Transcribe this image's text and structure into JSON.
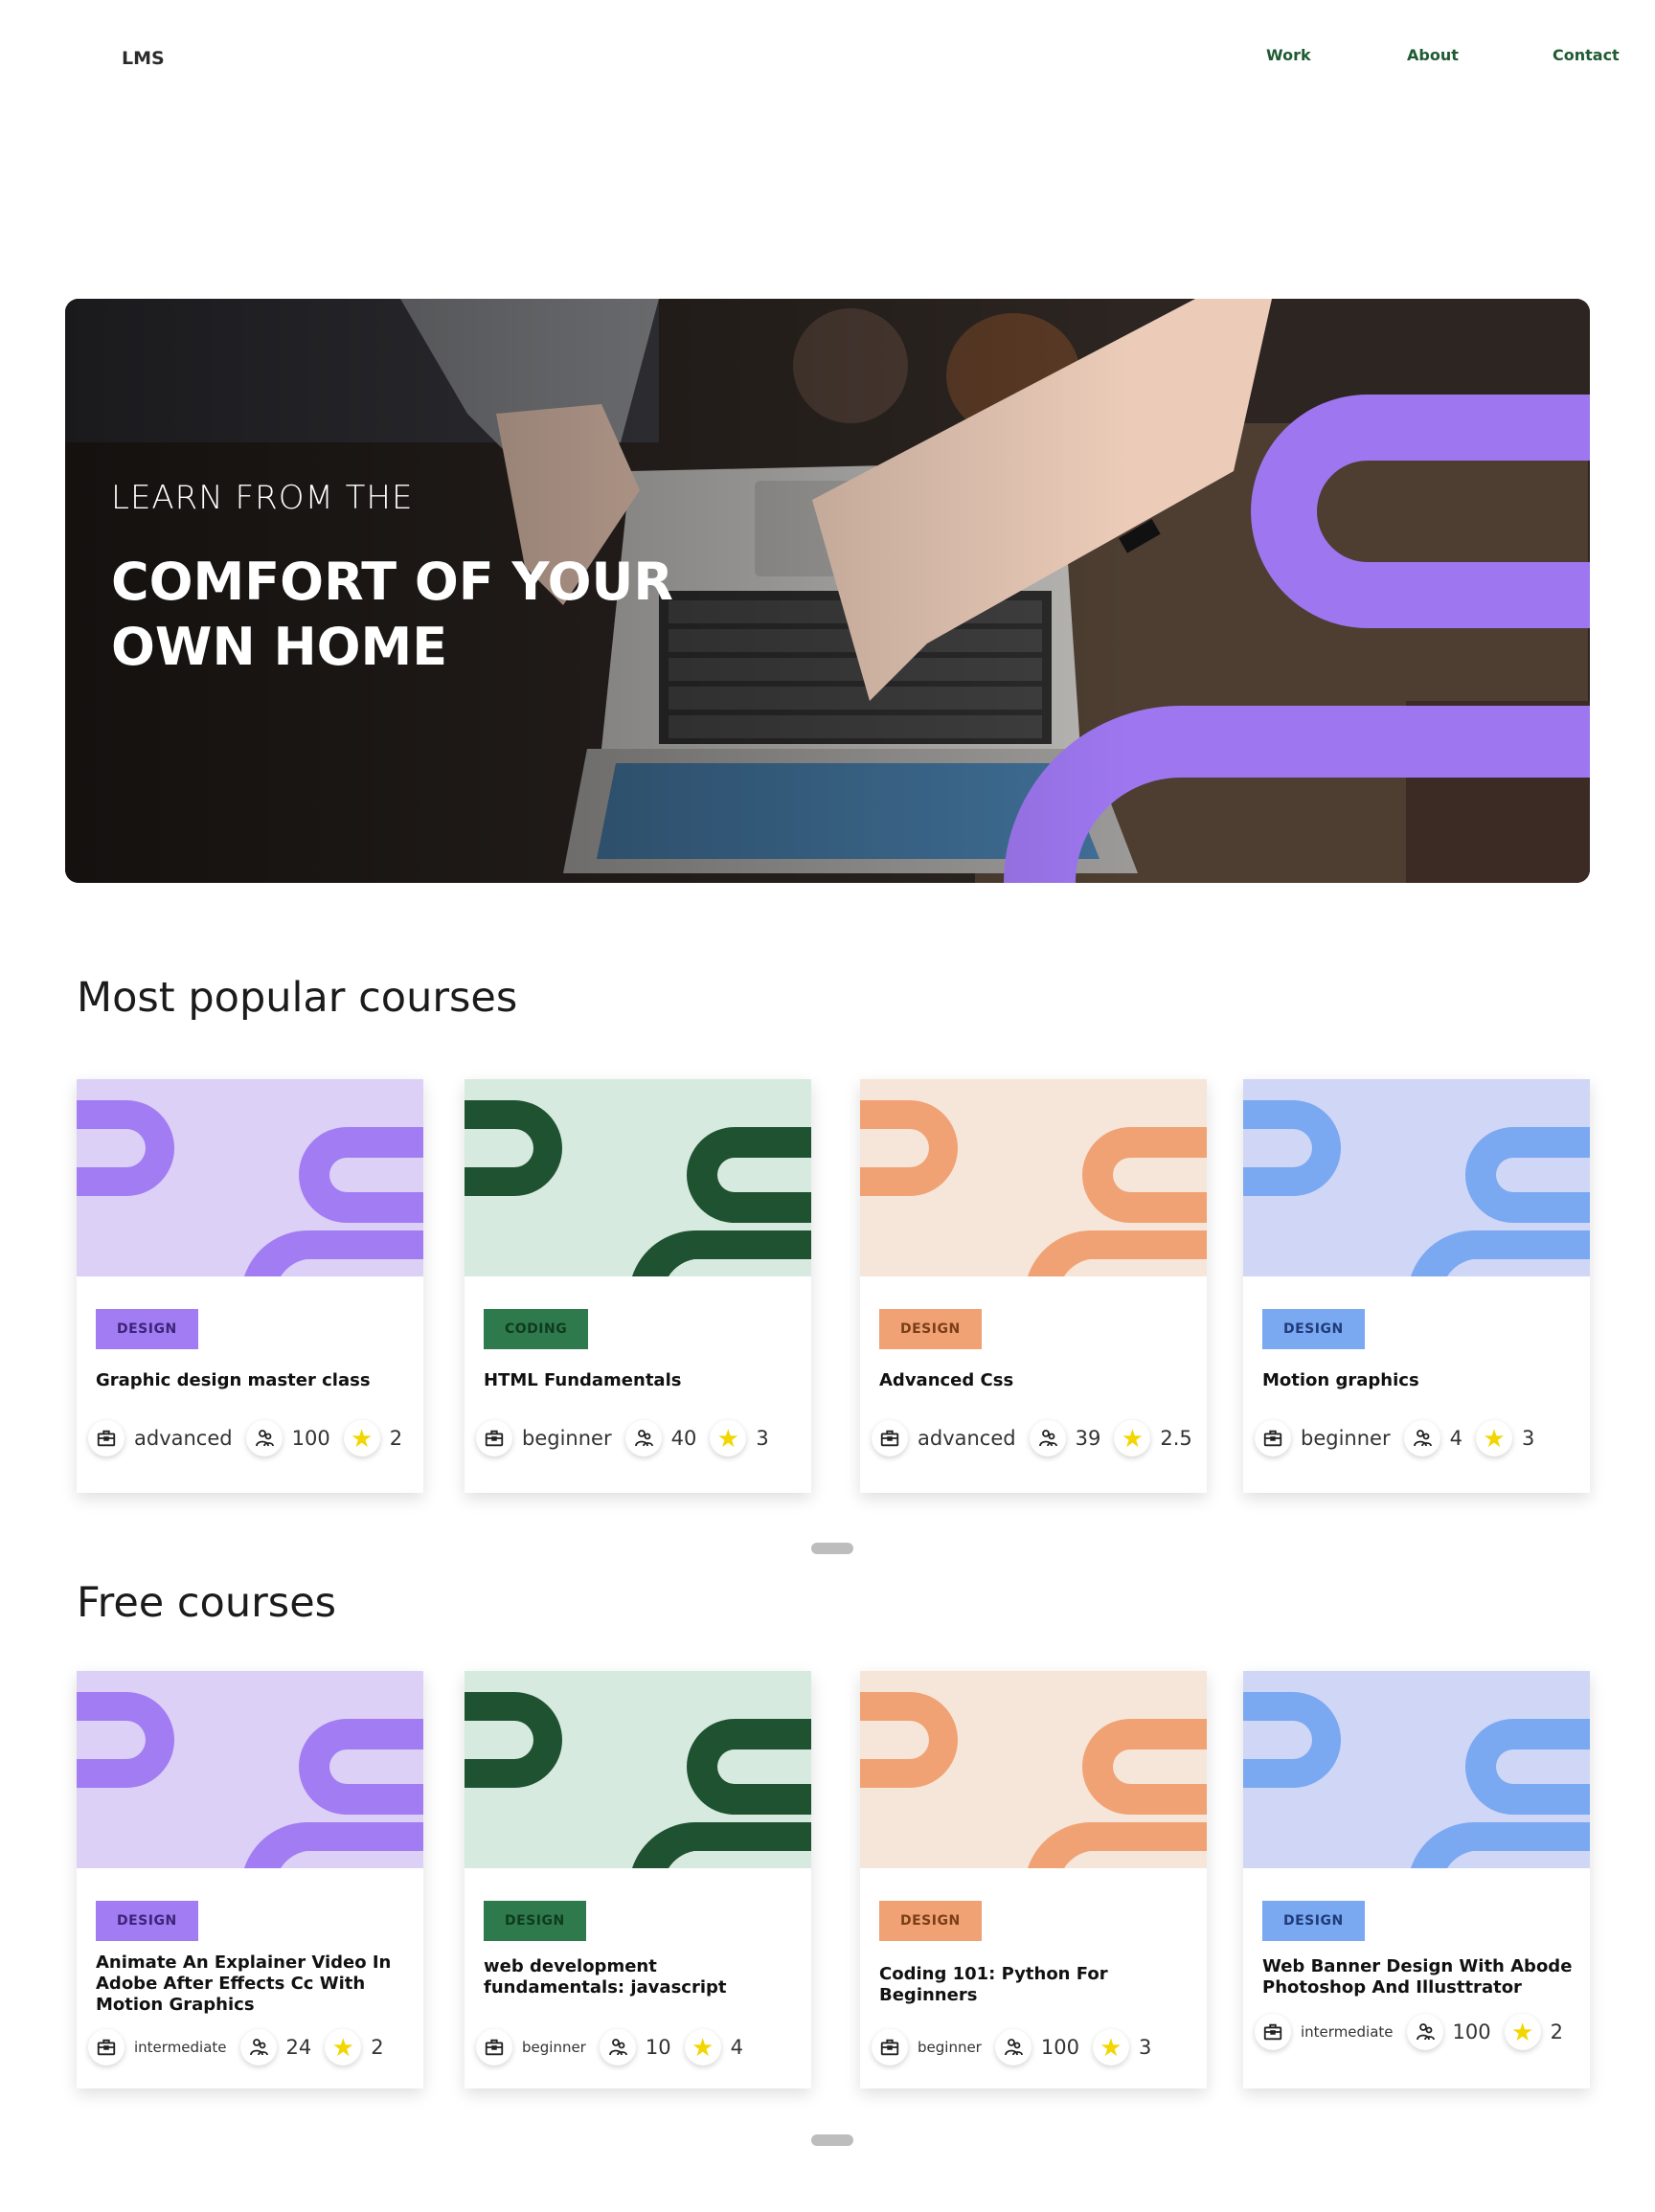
{
  "header": {
    "logo": "LMS",
    "nav": [
      {
        "label": "Work"
      },
      {
        "label": "About"
      },
      {
        "label": "Contact"
      }
    ]
  },
  "hero": {
    "kicker": "LEARN FROM THE",
    "title": "COMFORT OF YOUR OWN HOME",
    "accent_color": "#9e77f0"
  },
  "popular": {
    "title": "Most popular courses",
    "cards": [
      {
        "tag": "DESIGN",
        "title": "Graphic design master class",
        "level": "advanced",
        "students": "100",
        "rating": "2",
        "theme": "purple"
      },
      {
        "tag": "CODING",
        "title": "HTML Fundamentals",
        "level": "beginner",
        "students": "40",
        "rating": "3",
        "theme": "green"
      },
      {
        "tag": "DESIGN",
        "title": "Advanced Css",
        "level": "advanced",
        "students": "39",
        "rating": "2.5",
        "theme": "orange"
      },
      {
        "tag": "DESIGN",
        "title": "Motion graphics",
        "level": "beginner",
        "students": "4",
        "rating": "3",
        "theme": "blue"
      }
    ]
  },
  "free": {
    "title": "Free courses",
    "cards": [
      {
        "tag": "DESIGN",
        "title": "Animate An Explainer Video In Adobe After Effects Cc With Motion Graphics",
        "level": "intermediate",
        "students": "24",
        "rating": "2",
        "theme": "purple"
      },
      {
        "tag": "DESIGN",
        "title": "web development fundamentals: javascript",
        "level": "beginner",
        "students": "10",
        "rating": "4",
        "theme": "green"
      },
      {
        "tag": "DESIGN",
        "title": "Coding 101: Python For Beginners",
        "level": "beginner",
        "students": "100",
        "rating": "3",
        "theme": "orange"
      },
      {
        "tag": "DESIGN",
        "title": "Web Banner Design With Abode Photoshop And Illusttrator",
        "level": "intermediate",
        "students": "100",
        "rating": "2",
        "theme": "blue"
      }
    ]
  },
  "themes": {
    "purple": {
      "bg": "#dcd0f6",
      "shape": "#a27cf2",
      "tag_bg": "#a27cf2",
      "tag_fg": "#3d2379"
    },
    "green": {
      "bg": "#d7eadf",
      "shape": "#1f5230",
      "tag_bg": "#2e7a4c",
      "tag_fg": "#0f3a20"
    },
    "orange": {
      "bg": "#f6e6d9",
      "shape": "#f0a274",
      "tag_bg": "#f0a274",
      "tag_fg": "#7a3d17"
    },
    "blue": {
      "bg": "#d0d6f6",
      "shape": "#7aa8f1",
      "tag_bg": "#7aa8f1",
      "tag_fg": "#1f3b7a"
    }
  }
}
